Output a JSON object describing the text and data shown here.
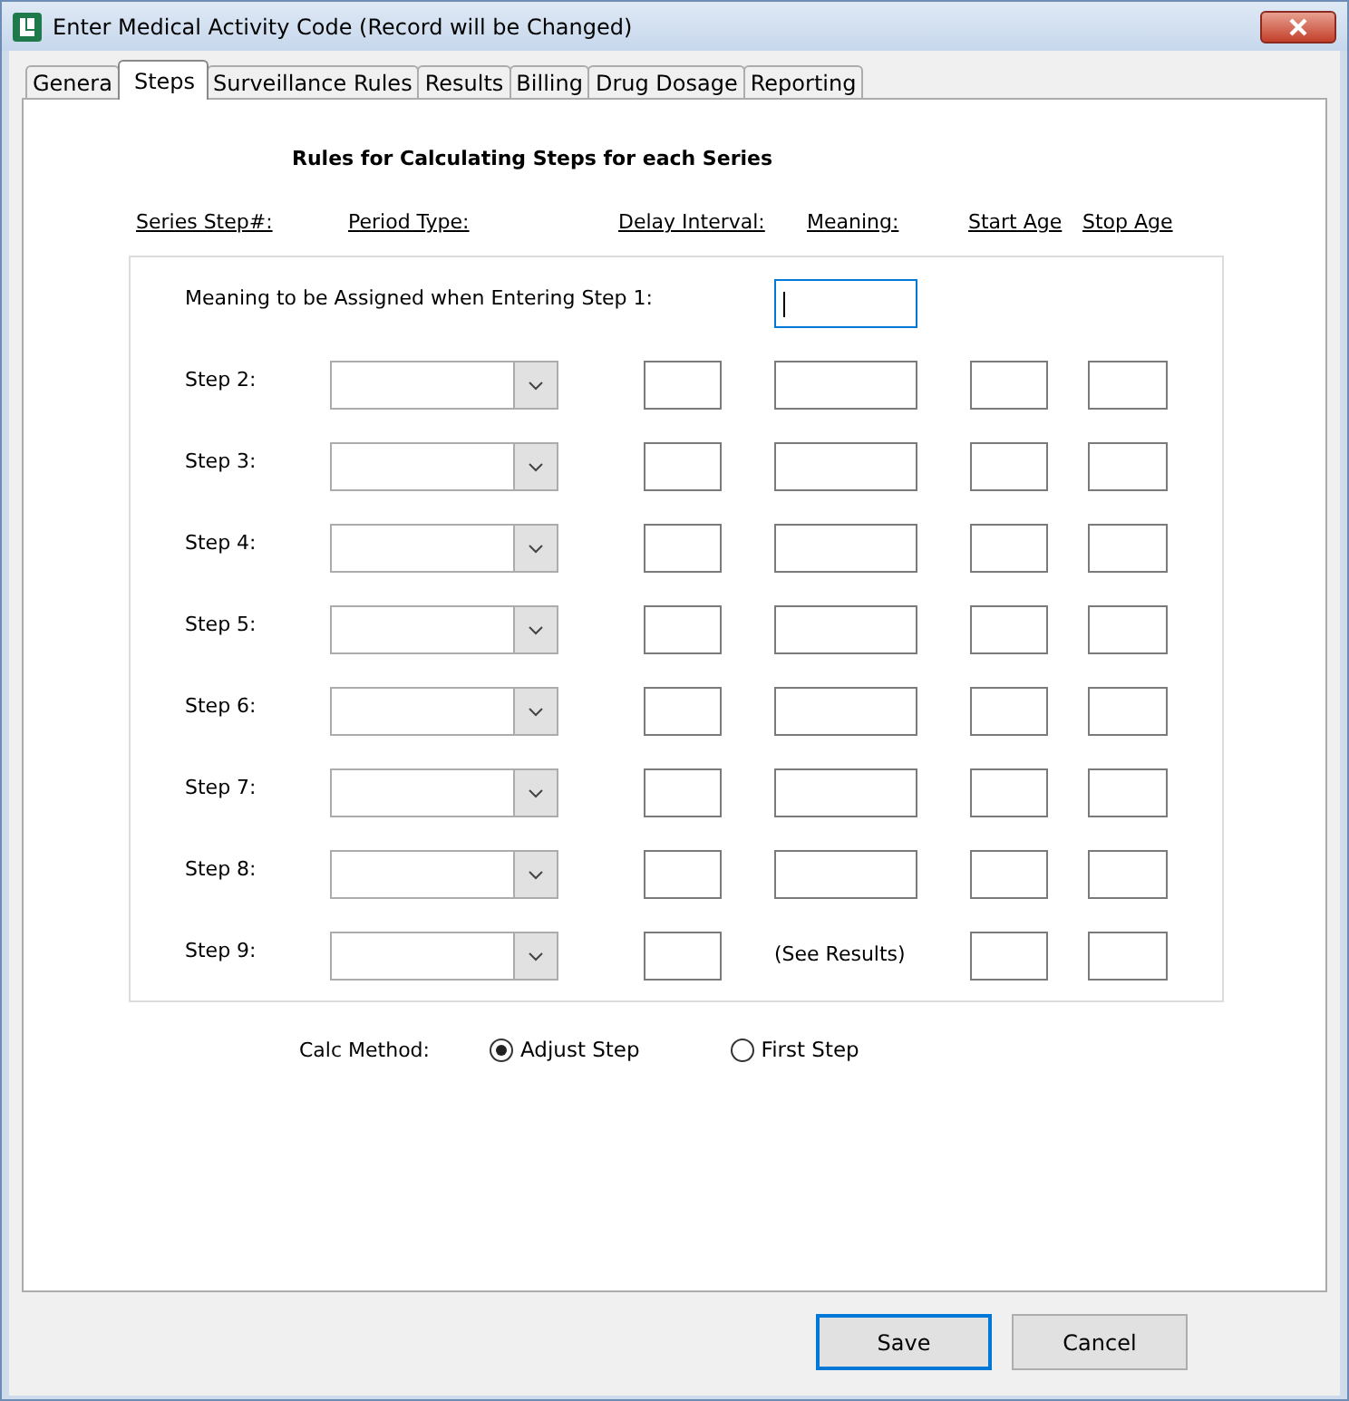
{
  "window": {
    "title": "Enter Medical Activity Code  (Record will be Changed)"
  },
  "tabs": [
    {
      "label": "Genera",
      "selected": false
    },
    {
      "label": "Steps",
      "selected": true
    },
    {
      "label": "Surveillance Rules",
      "selected": false
    },
    {
      "label": "Results",
      "selected": false
    },
    {
      "label": "Billing",
      "selected": false
    },
    {
      "label": "Drug Dosage",
      "selected": false
    },
    {
      "label": "Reporting",
      "selected": false
    }
  ],
  "heading": "Rules for Calculating Steps for each Series",
  "columns": [
    "Series Step#:",
    "Period Type:",
    "Delay Interval:",
    "Meaning:",
    "Start Age",
    "Stop Age"
  ],
  "first_step": {
    "label": "Meaning to be Assigned when Entering Step 1:",
    "focused": true
  },
  "steps": [
    {
      "label": "Step 2:",
      "meaning": {
        "kind": "field"
      }
    },
    {
      "label": "Step 3:",
      "meaning": {
        "kind": "field"
      }
    },
    {
      "label": "Step 4:",
      "meaning": {
        "kind": "field"
      }
    },
    {
      "label": "Step 5:",
      "meaning": {
        "kind": "field"
      }
    },
    {
      "label": "Step 6:",
      "meaning": {
        "kind": "field"
      }
    },
    {
      "label": "Step 7:",
      "meaning": {
        "kind": "field"
      }
    },
    {
      "label": "Step 8:",
      "meaning": {
        "kind": "field"
      }
    },
    {
      "label": "Step 9:",
      "meaning": {
        "kind": "text",
        "text": "(See Results)"
      }
    }
  ],
  "calc_method": {
    "label": "Calc Method:",
    "options": [
      {
        "label": "Adjust Step",
        "selected": true
      },
      {
        "label": "First Step",
        "selected": false
      }
    ]
  },
  "buttons": [
    {
      "label": "Save",
      "default": true
    },
    {
      "label": "Cancel",
      "default": false
    }
  ]
}
